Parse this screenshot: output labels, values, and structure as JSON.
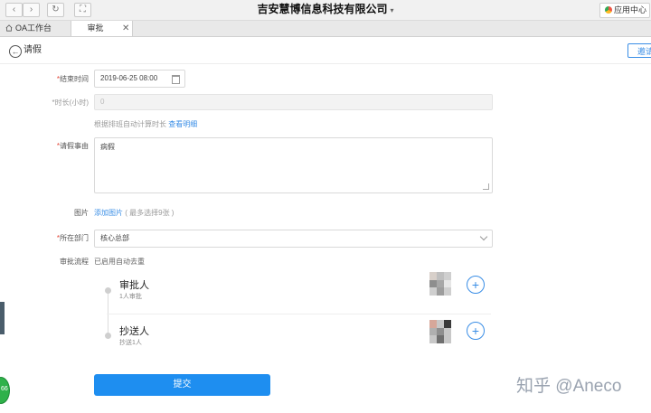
{
  "window": {
    "title": "吉安慧博信息科技有限公司",
    "title_caret": "▾",
    "app_center_label": "应用中心"
  },
  "nav": {
    "back_glyph": "‹",
    "forward_glyph": "›",
    "refresh_glyph": "↻",
    "fullscreen_glyph": "⛶"
  },
  "tabs": [
    {
      "label": "OA工作台",
      "icon": "home-icon"
    },
    {
      "label": "审批",
      "close": "✕",
      "active": true
    }
  ],
  "page": {
    "title": "请假",
    "top_right_button": "邀请"
  },
  "form": {
    "end_time": {
      "required_mark": "*",
      "label": "结束时间",
      "value": "2019-06-25 08:00"
    },
    "duration": {
      "required_mark": "*",
      "label": "时长(小时)",
      "value": "0"
    },
    "duration_hint": {
      "text": "根据排班自动计算时长",
      "link": "查看明细"
    },
    "reason": {
      "required_mark": "*",
      "label": "请假事由",
      "value": "病假"
    },
    "image": {
      "label": "图片",
      "link": "添加图片",
      "hint": "( 最多选择9张 )"
    },
    "department": {
      "required_mark": "*",
      "label": "所在部门",
      "value": "核心总部"
    },
    "flow": {
      "label": "审批流程",
      "hint": "已启用自动去重"
    }
  },
  "flow_steps": [
    {
      "title": "审批人",
      "subtitle": "1人审批"
    },
    {
      "title": "抄送人",
      "subtitle": "抄送1人"
    }
  ],
  "plus_glyph": "+",
  "submit_label": "提交",
  "watermark": "知乎 @Aneco",
  "badge_text": "66",
  "colors": {
    "primary": "#1e8ef0",
    "required": "#e5483a",
    "link": "#3a8ee6"
  }
}
